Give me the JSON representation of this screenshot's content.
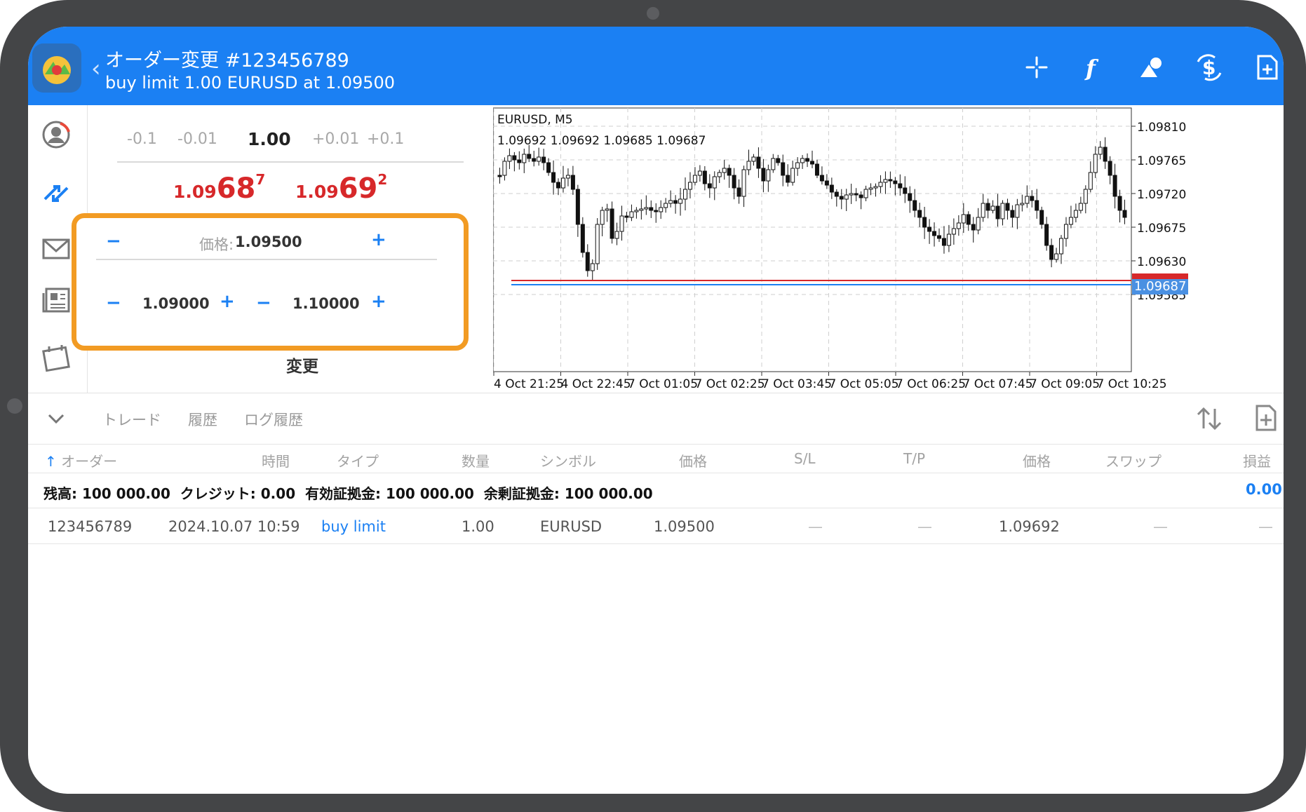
{
  "header": {
    "title": "オーダー変更 #123456789",
    "subtitle": "buy limit 1.00 EURUSD at 1.09500",
    "back": "‹"
  },
  "volume": {
    "minus_01": "-0.1",
    "minus_001": "-0.01",
    "value": "1.00",
    "plus_001": "+0.01",
    "plus_01": "+0.1"
  },
  "quotes": {
    "bid": {
      "small": "1.09",
      "big": "68",
      "pip": "7"
    },
    "ask": {
      "small": "1.09",
      "big": "69",
      "pip": "2"
    }
  },
  "price": {
    "label": "価格:",
    "value": "1.09500",
    "sl": "1.09000",
    "tp": "1.10000",
    "minus": "−",
    "plus": "+"
  },
  "modify_button": "変更",
  "chart": {
    "symbol": "EURUSD, M5",
    "ohlc": "1.09692 1.09692 1.09685 1.09687",
    "price_labels": [
      "1.09810",
      "1.09765",
      "1.09720",
      "1.09675",
      "1.09630",
      "1.09585"
    ],
    "current_price": "1.09687",
    "time_labels": [
      "4 Oct 21:25",
      "4 Oct 22:45",
      "7 Oct 01:05",
      "7 Oct 02:25",
      "7 Oct 03:45",
      "7 Oct 05:05",
      "7 Oct 06:25",
      "7 Oct 07:45",
      "7 Oct 09:05",
      "7 Oct 10:25"
    ],
    "colors": {
      "bid_line": "#d7282a",
      "ask_line": "#1b80f3",
      "price_tag": "#4a90e2"
    }
  },
  "tabs": [
    "トレード",
    "履歴",
    "ログ履歴"
  ],
  "columns": [
    "オーダー",
    "時間",
    "タイプ",
    "数量",
    "シンボル",
    "価格",
    "S/L",
    "T/P",
    "価格",
    "スワップ",
    "損益"
  ],
  "balance": {
    "balance_label": "残高:",
    "balance_value": "100 000.00",
    "credit_label": "クレジット:",
    "credit_value": "0.00",
    "equity_label": "有効証拠金:",
    "equity_value": "100 000.00",
    "free_margin_label": "余剰証拠金:",
    "free_margin_value": "100 000.00",
    "profit": "0.00"
  },
  "order_row": {
    "order": "123456789",
    "time": "2024.10.07 10:59",
    "type": "buy limit",
    "volume": "1.00",
    "symbol": "EURUSD",
    "price": "1.09500",
    "sl": "—",
    "tp": "—",
    "current": "1.09692",
    "swap": "—",
    "profit": "—"
  },
  "icons": [
    "crosshair-icon",
    "function-icon",
    "shapes-icon",
    "dollar-icon",
    "new-document-icon",
    "quotes-icon",
    "trade-icon",
    "mail-icon",
    "news-icon",
    "calendar-icon",
    "chevron-down-icon",
    "sort-icon"
  ]
}
